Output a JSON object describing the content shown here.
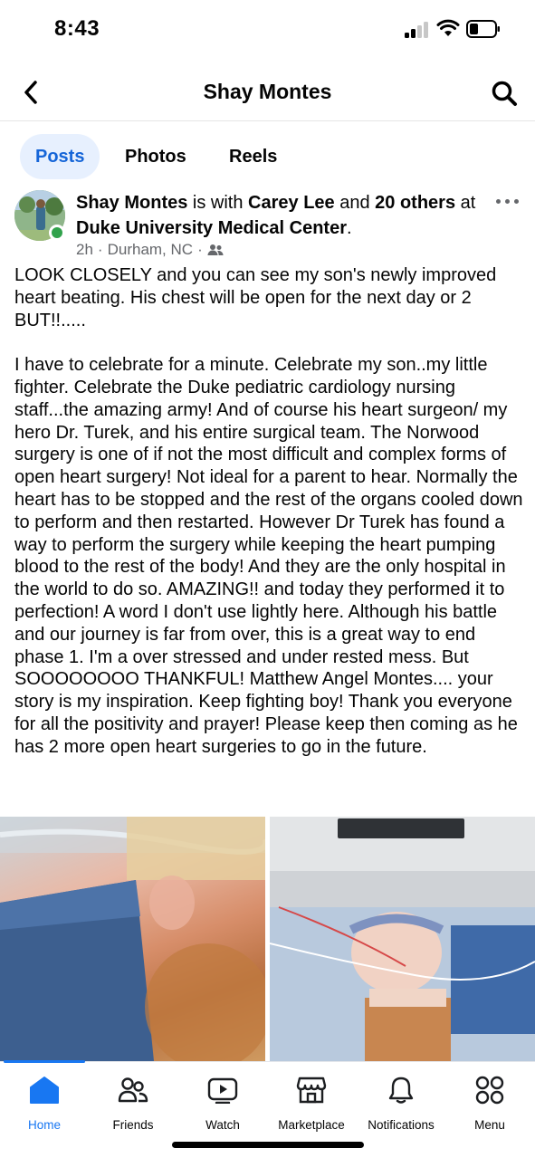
{
  "status_bar": {
    "time": "8:43"
  },
  "header": {
    "title": "Shay Montes"
  },
  "profile_tabs": [
    "Posts",
    "Photos",
    "Reels"
  ],
  "post": {
    "author": "Shay Montes",
    "with_text": " is with ",
    "tagged_person": "Carey Lee",
    "and_text": " and ",
    "others": "20 others",
    "at_text": " at ",
    "location": "Duke University Medical Center",
    "period": ".",
    "time_ago": "2h",
    "separator": "·",
    "city": "Durham, NC",
    "audience_icon": "friends-icon",
    "body": "LOOK CLOSELY and you can see my son's newly improved heart beating. His chest will be open for the next day or 2 BUT!!.....\n\nI have to celebrate for a minute. Celebrate my son..my little fighter. Celebrate the Duke pediatric cardiology nursing staff...the amazing army! And of course his heart surgeon/ my hero Dr. Turek, and his entire surgical team. The Norwood surgery is one of if not the most difficult and complex forms of open heart surgery! Not ideal for a parent to hear. Normally the heart has to be stopped and the rest of the organs cooled down to perform and then restarted. However Dr Turek has found a way to perform the surgery while keeping the heart pumping blood to the rest of the body! And they are the only hospital in the world to do so. AMAZING!! and today they performed it to perfection! A word I don't use lightly here. Although his battle and our journey is far from over, this is a great way to end phase 1. I'm a over stressed and under rested mess. But SOOOOOOOO THANKFUL! Matthew Angel Montes.... your story is my inspiration. Keep fighting boy! Thank you everyone for all the positivity and prayer! Please keep then coming as he has 2 more open heart surgeries to go in the future."
  },
  "bottom_nav": [
    {
      "label": "Home",
      "icon": "home-icon",
      "active": true
    },
    {
      "label": "Friends",
      "icon": "friends-icon",
      "active": false
    },
    {
      "label": "Watch",
      "icon": "watch-icon",
      "active": false
    },
    {
      "label": "Marketplace",
      "icon": "marketplace-icon",
      "active": false
    },
    {
      "label": "Notifications",
      "icon": "bell-icon",
      "active": false
    },
    {
      "label": "Menu",
      "icon": "menu-grid-icon",
      "active": false
    }
  ],
  "colors": {
    "accent": "#1877f2",
    "active_tab_bg": "#e7f0fe",
    "muted": "#65676b",
    "online": "#31a24c"
  }
}
